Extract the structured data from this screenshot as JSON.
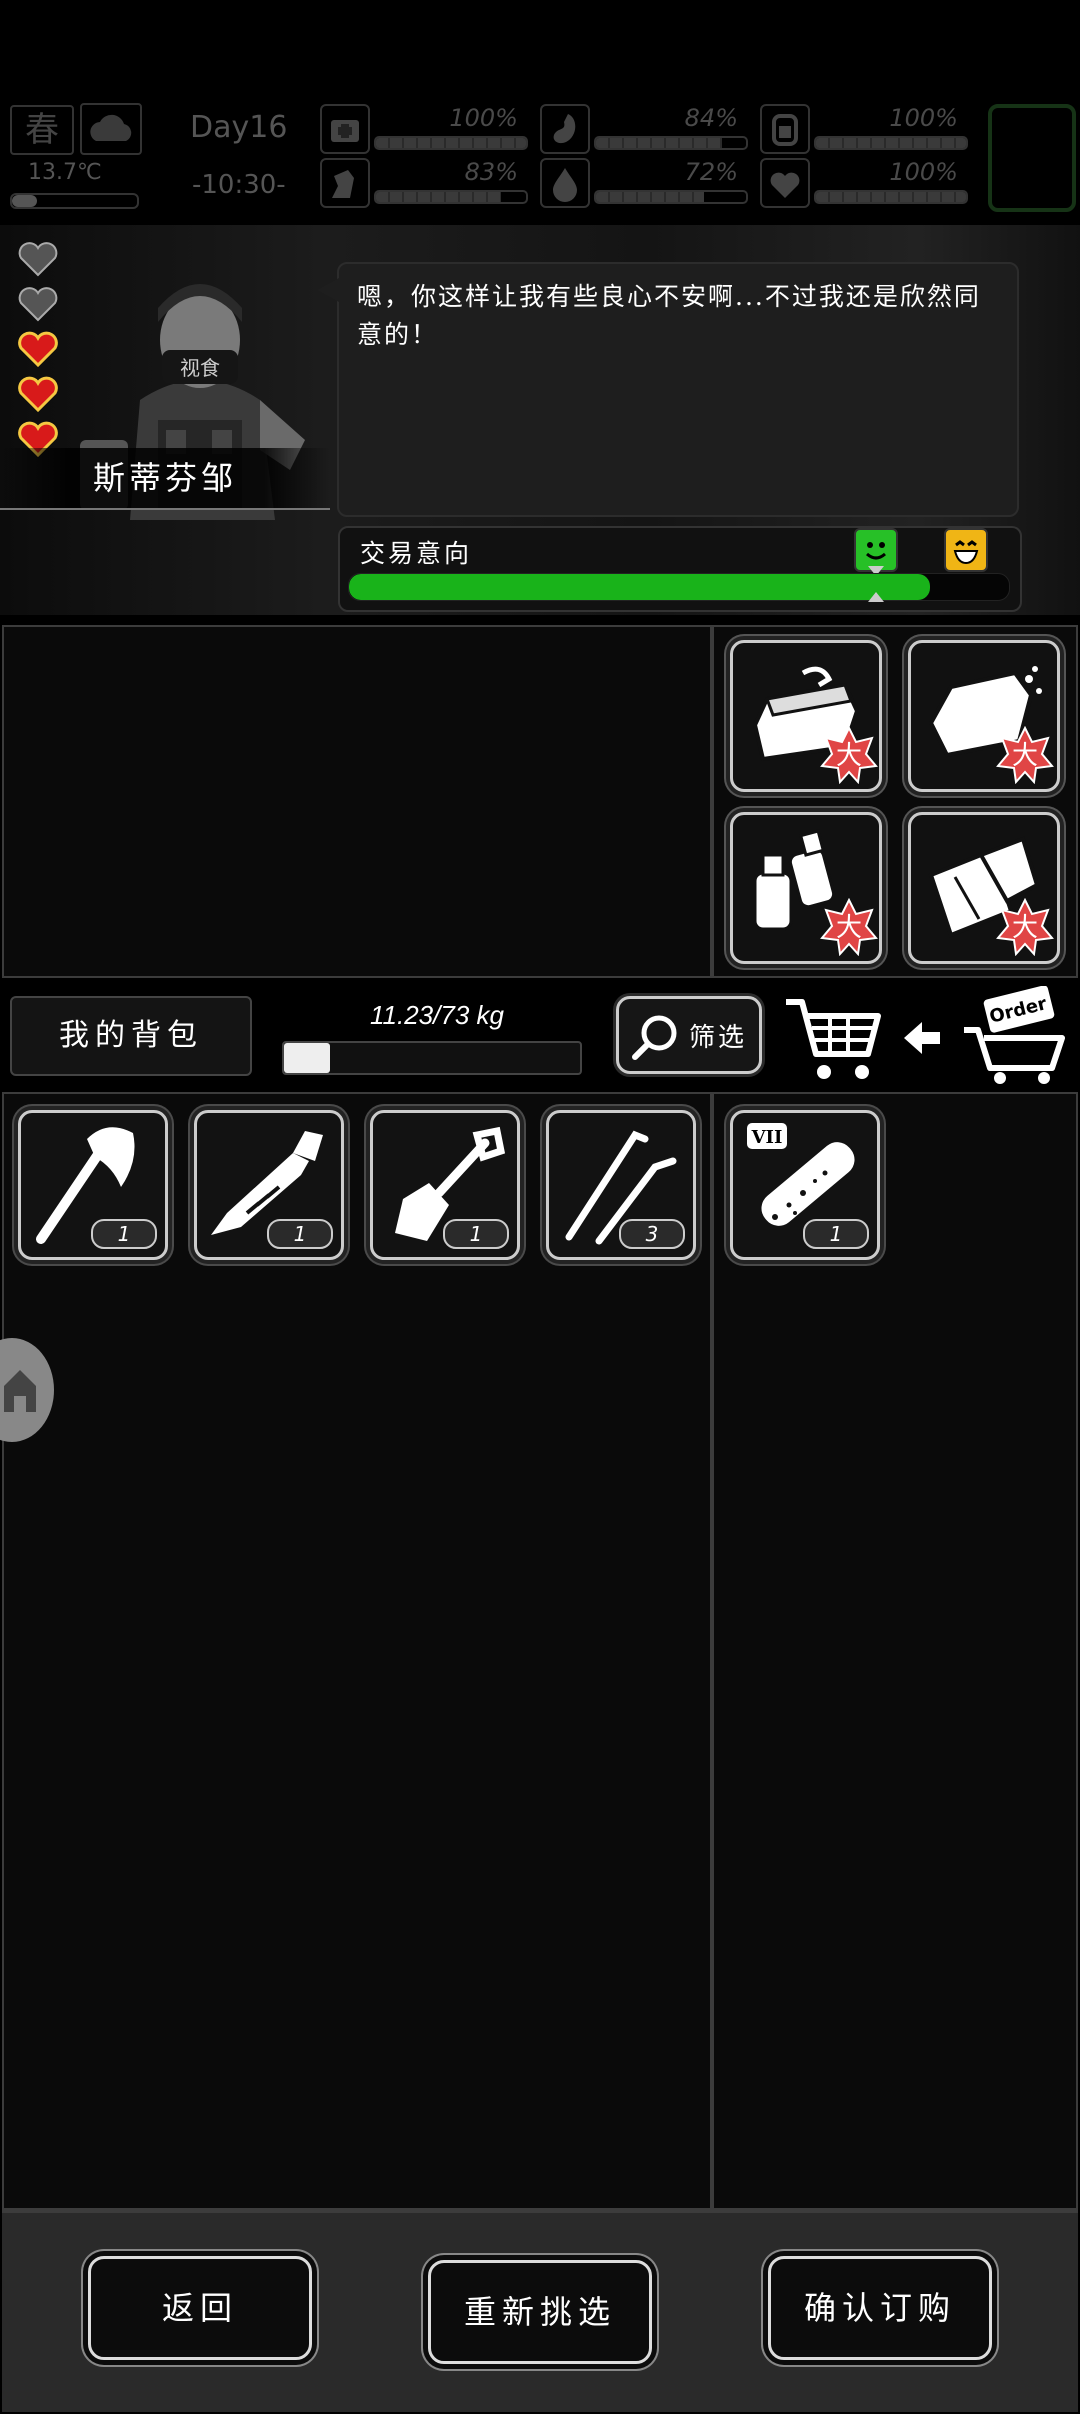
{
  "status": {
    "season": "春",
    "temperature": "13.7℃",
    "day": "Day16",
    "time": "-10:30-",
    "stats": [
      {
        "name": "health",
        "icon": "medkit-icon",
        "value": "100%",
        "fill": 1.0
      },
      {
        "name": "hunger",
        "icon": "stomach-icon",
        "value": "84%",
        "fill": 0.84
      },
      {
        "name": "energy",
        "icon": "battery-icon",
        "value": "100%",
        "fill": 1.0
      },
      {
        "name": "sanity",
        "icon": "mind-icon",
        "value": "83%",
        "fill": 0.83
      },
      {
        "name": "thirst",
        "icon": "water-drop-icon",
        "value": "72%",
        "fill": 0.72
      },
      {
        "name": "mood",
        "icon": "heart-icon",
        "value": "100%",
        "fill": 1.0
      }
    ]
  },
  "npc": {
    "name": "斯蒂芬邹",
    "affection_hearts": [
      false,
      false,
      true,
      true,
      true
    ],
    "dialogue": "嗯，你这样让我有些良心不安啊...不过我还是欣然同意的！"
  },
  "trade": {
    "label": "交易意向",
    "willingness": 0.88,
    "faces": [
      "happy-face-icon",
      "laughing-face-icon"
    ]
  },
  "trader_items": [
    {
      "icon": "canned-food-icon",
      "badge": "大"
    },
    {
      "icon": "bread-icon",
      "badge": "大"
    },
    {
      "icon": "bottles-icon",
      "badge": "大"
    },
    {
      "icon": "scrolls-icon",
      "badge": "大"
    }
  ],
  "inventory": {
    "bag_label": "我的背包",
    "weight": "11.23/73 kg",
    "weight_fill": 0.154,
    "filter_label": "筛选",
    "my_items": [
      {
        "icon": "axe-icon",
        "qty": "1"
      },
      {
        "icon": "machete-icon",
        "qty": "1"
      },
      {
        "icon": "shovel-icon",
        "qty": "1"
      },
      {
        "icon": "lockpick-icon",
        "qty": "3"
      }
    ],
    "selected_items": [
      {
        "icon": "test-tube-icon",
        "tag": "VII",
        "qty": "1"
      }
    ]
  },
  "order_label": "Order",
  "buttons": {
    "back": "返回",
    "reselect": "重新挑选",
    "confirm": "确认订购"
  },
  "colors": {
    "trade_bar": "#19b31a",
    "heart_full": "#d81a1a",
    "badge": "#e04545"
  }
}
